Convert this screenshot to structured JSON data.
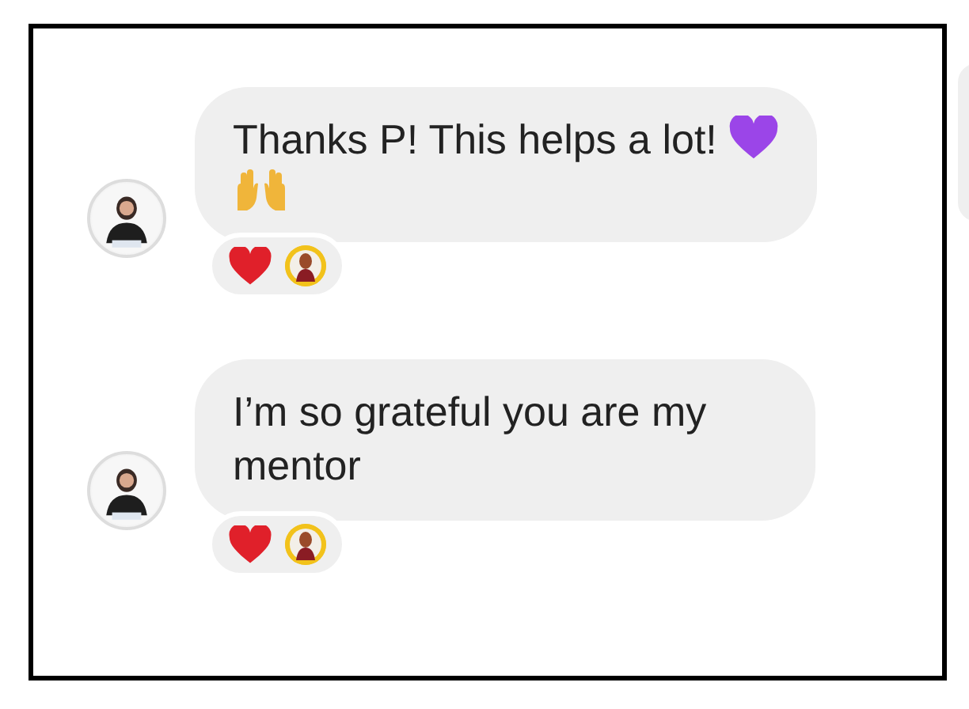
{
  "messages": [
    {
      "kind": "text-with-emoji",
      "text": "Thanks P! This helps a lot!",
      "reacted": true
    },
    {
      "kind": "text",
      "text": "I’m so grateful you are my mentor",
      "reacted": true
    }
  ]
}
